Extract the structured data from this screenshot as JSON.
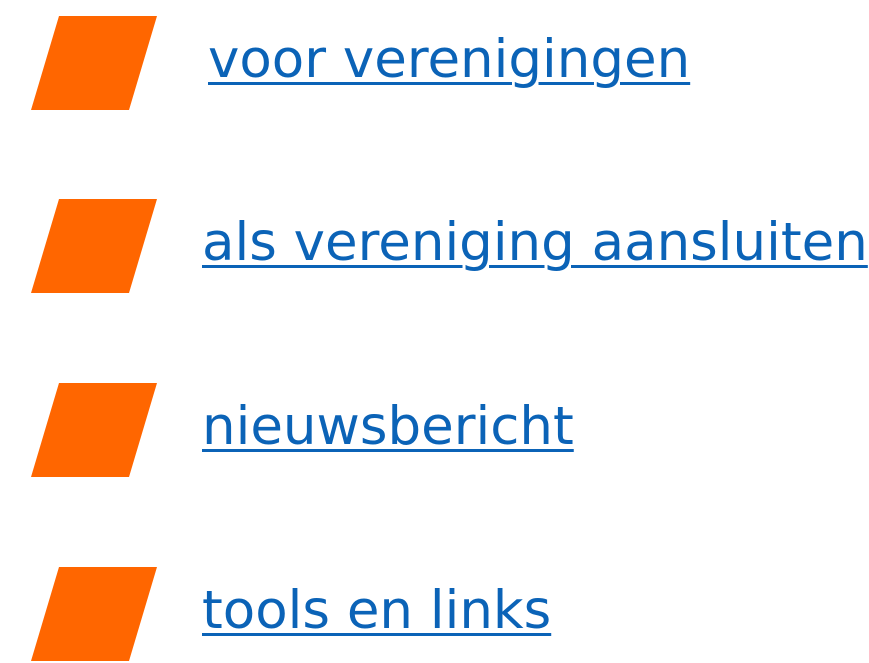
{
  "theme": {
    "accent": "#FF6600",
    "link": "#0B63B7"
  },
  "links": [
    {
      "label": "voor verenigingen",
      "icon": "orange-parallelogram-bullet"
    },
    {
      "label": "als vereniging aansluiten",
      "icon": "orange-parallelogram-bullet"
    },
    {
      "label": "nieuwsbericht",
      "icon": "orange-parallelogram-bullet"
    },
    {
      "label": "tools en links",
      "icon": "orange-parallelogram-bullet"
    }
  ]
}
